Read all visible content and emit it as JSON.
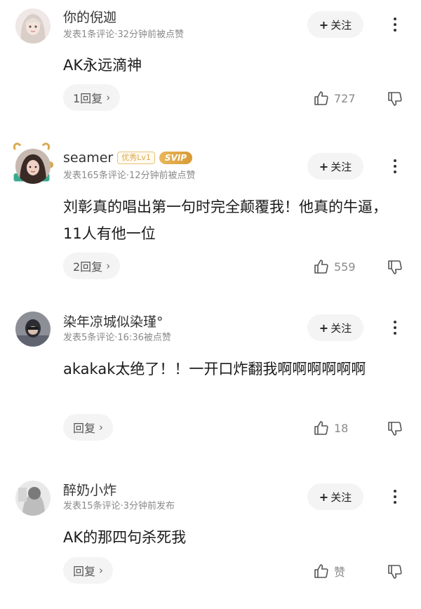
{
  "comments": [
    {
      "username": "你的倪迦",
      "badges": [],
      "meta": "发表1条评论·32分钟前被点赞",
      "text": "AK永远滴神",
      "reply": "1回复",
      "likes": "727",
      "follow": "关注"
    },
    {
      "username": "seamer",
      "badges": [
        "优秀Lv1",
        "SVIP"
      ],
      "meta": "发表165条评论·12分钟前被点赞",
      "text": "刘彰真的唱出第一句时完全颠覆我！他真的牛逼，11人有他一位",
      "reply": "2回复",
      "likes": "559",
      "follow": "关注"
    },
    {
      "username": "染年凉城似染瑾°",
      "badges": [],
      "meta": "发表5条评论·16:36被点赞",
      "text": "akakak太绝了！！一开口炸翻我啊啊啊啊啊啊",
      "reply": "回复",
      "likes": "18",
      "follow": "关注"
    },
    {
      "username": "醉奶小炸",
      "badges": [],
      "meta": "发表15条评论·3分钟前发布",
      "text": "AK的那四句杀死我",
      "reply": "回复",
      "likes": "赞",
      "follow": "关注"
    }
  ],
  "icons": {
    "follow": "plus-icon",
    "more": "more-vertical-icon",
    "like": "thumbs-up-icon",
    "dislike": "thumbs-down-icon",
    "reply_chevron": "chevron-right-icon"
  },
  "colors": {
    "badge_gold": "#d9a84c",
    "meta_gray": "#8a8a8a",
    "button_bg": "#f4f4f4"
  }
}
